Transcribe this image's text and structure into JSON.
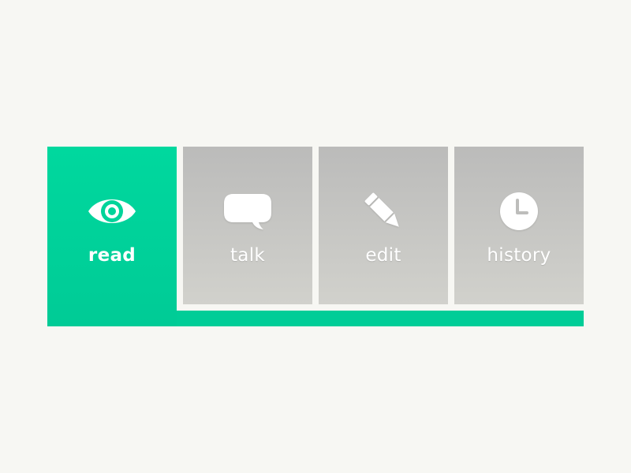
{
  "colors": {
    "accent": "#00d49a",
    "inactive_tab_top": "#bbbbba",
    "inactive_tab_bottom": "#d1d1cc",
    "background": "#f7f7f3",
    "label": "#ffffff"
  },
  "tabs": [
    {
      "label": "read",
      "icon": "eye-icon",
      "active": true
    },
    {
      "label": "talk",
      "icon": "speech-bubble-icon",
      "active": false
    },
    {
      "label": "edit",
      "icon": "pencil-icon",
      "active": false
    },
    {
      "label": "history",
      "icon": "clock-icon",
      "active": false
    }
  ]
}
